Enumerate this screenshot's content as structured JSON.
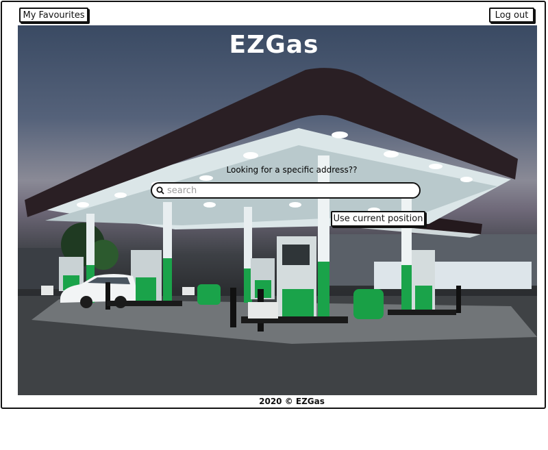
{
  "header": {
    "favourites_label": "My Favourites",
    "logout_label": "Log out"
  },
  "hero": {
    "title": "EZGas",
    "prompt": "Looking for a specific address??",
    "search_placeholder": "search",
    "current_position_label": "Use current position"
  },
  "footer": {
    "text": "2020 © EZGas"
  },
  "colors": {
    "accent_green": "#1aa34a",
    "canopy_dark": "#2a1f24",
    "frame": "#111111"
  }
}
